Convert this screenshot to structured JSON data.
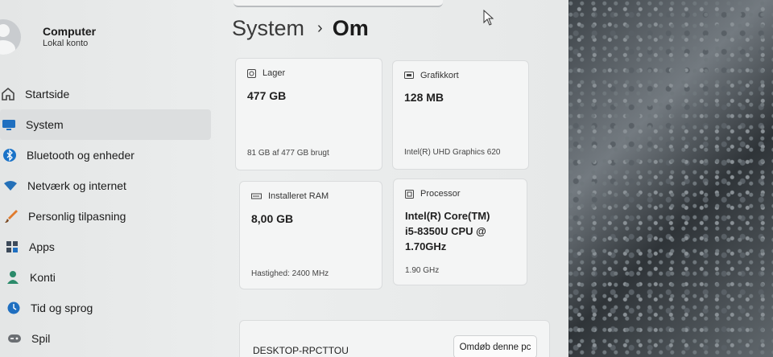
{
  "profile": {
    "name": "Computer",
    "subtitle": "Lokal konto"
  },
  "sidebar": {
    "items": [
      {
        "label": "Startside",
        "icon": "home-icon"
      },
      {
        "label": "System",
        "icon": "system-icon",
        "active": true
      },
      {
        "label": "Bluetooth og enheder",
        "icon": "bluetooth-icon"
      },
      {
        "label": "Netværk og internet",
        "icon": "network-icon"
      },
      {
        "label": "Personlig tilpasning",
        "icon": "brush-icon"
      },
      {
        "label": "Apps",
        "icon": "apps-icon"
      },
      {
        "label": "Konti",
        "icon": "accounts-icon"
      },
      {
        "label": "Tid og sprog",
        "icon": "clock-icon"
      },
      {
        "label": "Spil",
        "icon": "game-icon"
      }
    ]
  },
  "breadcrumb": {
    "parent": "System",
    "separator": "›",
    "current": "Om"
  },
  "specs": {
    "storage": {
      "label": "Lager",
      "value": "477 GB",
      "detail": "81 GB af 477 GB brugt"
    },
    "graphics": {
      "label": "Grafikkort",
      "value": "128 MB",
      "detail": "Intel(R) UHD Graphics 620"
    },
    "ram": {
      "label": "Installeret RAM",
      "value": "8,00 GB",
      "detail": "Hastighed: 2400 MHz"
    },
    "processor": {
      "label": "Processor",
      "value_lines": [
        "Intel(R) Core(TM)",
        "i5-8350U CPU @",
        "1.70GHz"
      ],
      "detail": "1.90 GHz"
    }
  },
  "device": {
    "name": "DESKTOP-RPCTTOU",
    "rename_label": "Omdøb denne pc"
  },
  "colors": {
    "accent": "#0067c0"
  }
}
